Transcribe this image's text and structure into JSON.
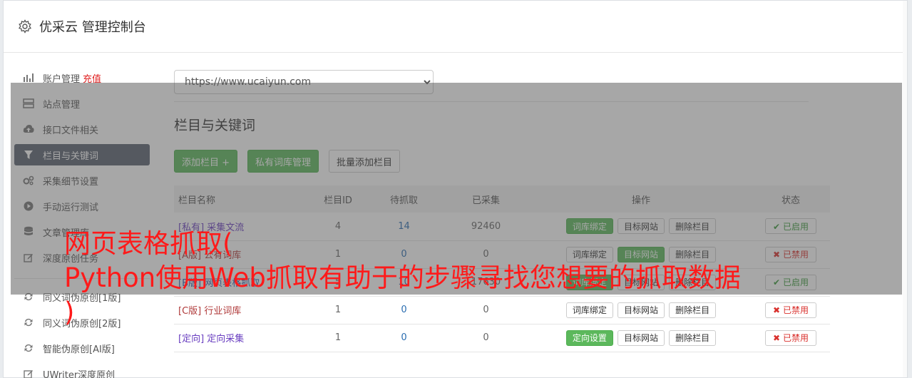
{
  "header": {
    "title": "优采云 管理控制台",
    "icon": "gear-icon"
  },
  "sidebar": {
    "items": [
      {
        "label": "账户管理",
        "extra": "充值",
        "icon": "bar-chart-icon"
      },
      {
        "label": "站点管理",
        "icon": "server-icon"
      },
      {
        "label": "接口文件相关",
        "icon": "cloud-upload-icon"
      },
      {
        "label": "栏目与关键词",
        "icon": "filter-icon",
        "active": true
      },
      {
        "label": "采集细节设置",
        "icon": "cogs-icon"
      },
      {
        "label": "手动运行测试",
        "icon": "play-circle-icon"
      },
      {
        "label": "文章管理库",
        "icon": "database-icon"
      },
      {
        "label": "深度原创任务",
        "icon": "edit-icon"
      },
      {
        "label": "同义词伪原创[1版]",
        "icon": "refresh-icon"
      },
      {
        "label": "同义词伪原创[2版]",
        "icon": "refresh-icon"
      },
      {
        "label": "智能伪原创[AI版]",
        "icon": "refresh-icon"
      },
      {
        "label": "UWriter深度原创",
        "icon": "edit-icon"
      }
    ]
  },
  "main": {
    "site_select": "https://www.ucaiyun.com",
    "section_title": "栏目与关键词",
    "buttons": {
      "add": "添加栏目 +",
      "private_lib": "私有词库管理",
      "batch_add": "批量添加栏目"
    },
    "table": {
      "headers": [
        "栏目名称",
        "栏目ID",
        "待抓取",
        "已采集",
        "操作",
        "状态"
      ],
      "rows": [
        {
          "prefix": "[私有]",
          "name": "采集文流",
          "id": "4",
          "pending": "14",
          "collected": "92460",
          "b1": "词库绑定",
          "b2": "目标网站",
          "b3": "删除栏目",
          "status": "已启用"
        },
        {
          "prefix": "[A版]",
          "name": "公有词库",
          "id": "1",
          "pending": "0",
          "collected": "0",
          "b1": "词库绑定",
          "b2": "目标网站",
          "b3": "删除栏目",
          "status": "已禁用"
        },
        {
          "prefix": "[B版]",
          "name": "网页表格抓取",
          "id": "5",
          "pending": "10",
          "collected": "17630",
          "b1": "词库绑定",
          "b2": "目标网站",
          "b3": "删除栏目",
          "status": "已启用"
        },
        {
          "prefix": "[C版]",
          "name": "行业词库",
          "id": "1",
          "pending": "0",
          "collected": "0",
          "b1": "词库绑定",
          "b2": "目标网站",
          "b3": "删除栏目",
          "status": "已禁用"
        },
        {
          "prefix": "[定向]",
          "name": "定向采集",
          "id": "1",
          "pending": "0",
          "collected": "0",
          "b1": "定向设置",
          "b2": "目标网站",
          "b3": "删除栏目",
          "status": "已禁用"
        }
      ]
    }
  },
  "overlay": {
    "line1": "网页表格抓取(",
    "line2": "Python使用Web抓取有助于的步骤寻找您想要的抓取数据",
    "line3": ")"
  },
  "colors": {
    "green": "#5cb85c",
    "active_nav": "#5a6270",
    "red_text": "#ff1a1a"
  }
}
